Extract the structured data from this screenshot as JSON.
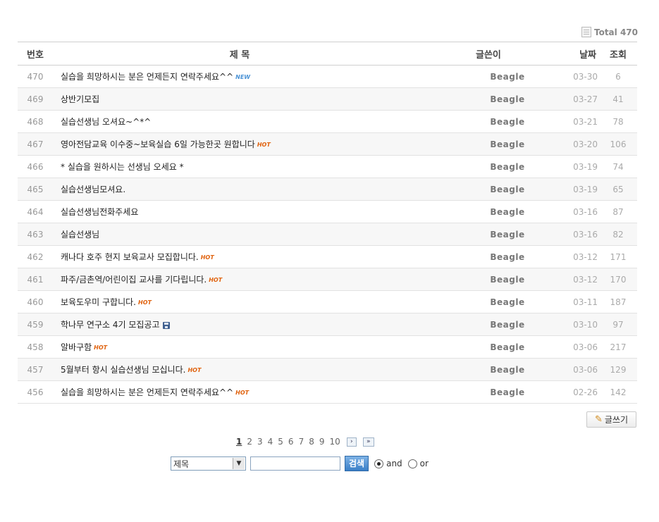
{
  "board": {
    "total_label": "Total 470",
    "columns": {
      "no": "번호",
      "title": "제 목",
      "writer": "글쓴이",
      "date": "날짜",
      "hits": "조회"
    },
    "rows": [
      {
        "no": "470",
        "title": "실습을 희망하시는 분은 언제든지 연락주세요^^",
        "badge": "NEW",
        "writer": "Beagle",
        "date": "03-30",
        "hits": "6"
      },
      {
        "no": "469",
        "title": "상반기모집",
        "badge": "",
        "writer": "Beagle",
        "date": "03-27",
        "hits": "41"
      },
      {
        "no": "468",
        "title": "실습선생님 오셔요~^*^",
        "badge": "",
        "writer": "Beagle",
        "date": "03-21",
        "hits": "78"
      },
      {
        "no": "467",
        "title": "영아전담교육 이수중~보육실습 6일 가능한곳 원합니다",
        "badge": "HOT",
        "writer": "Beagle",
        "date": "03-20",
        "hits": "106"
      },
      {
        "no": "466",
        "title": "* 실습을 원하시는 선생님 오세요 *",
        "badge": "",
        "writer": "Beagle",
        "date": "03-19",
        "hits": "74"
      },
      {
        "no": "465",
        "title": "실습선생님모셔요.",
        "badge": "",
        "writer": "Beagle",
        "date": "03-19",
        "hits": "65"
      },
      {
        "no": "464",
        "title": "실습선생님전화주세요",
        "badge": "",
        "writer": "Beagle",
        "date": "03-16",
        "hits": "87"
      },
      {
        "no": "463",
        "title": "실습선생님",
        "badge": "",
        "writer": "Beagle",
        "date": "03-16",
        "hits": "82"
      },
      {
        "no": "462",
        "title": "캐나다 호주 현지 보육교사 모집합니다.",
        "badge": "HOT",
        "writer": "Beagle",
        "date": "03-12",
        "hits": "171"
      },
      {
        "no": "461",
        "title": "파주/금촌역/어린이집 교사를 기다립니다.",
        "badge": "HOT",
        "writer": "Beagle",
        "date": "03-12",
        "hits": "170"
      },
      {
        "no": "460",
        "title": "보육도우미 구합니다.",
        "badge": "HOT",
        "writer": "Beagle",
        "date": "03-11",
        "hits": "187"
      },
      {
        "no": "459",
        "title": "학나무 연구소 4기 모집공고",
        "badge": "",
        "attachment": true,
        "writer": "Beagle",
        "date": "03-10",
        "hits": "97"
      },
      {
        "no": "458",
        "title": "알바구함",
        "badge": "HOT",
        "writer": "Beagle",
        "date": "03-06",
        "hits": "217"
      },
      {
        "no": "457",
        "title": "5월부터 항시 실습선생님 모십니다.",
        "badge": "HOT",
        "writer": "Beagle",
        "date": "03-06",
        "hits": "129"
      },
      {
        "no": "456",
        "title": "실습을 희망하시는 분은 언제든지 연락주세요^^",
        "badge": "HOT",
        "writer": "Beagle",
        "date": "02-26",
        "hits": "142"
      }
    ]
  },
  "write_button": {
    "label": "글쓰기",
    "icon": "pencil-icon"
  },
  "pagination": {
    "pages": [
      "1",
      "2",
      "3",
      "4",
      "5",
      "6",
      "7",
      "8",
      "9",
      "10"
    ],
    "current": "1"
  },
  "search": {
    "field_selected": "제목",
    "query_value": "",
    "button_label": "검색",
    "options": [
      {
        "label": "and",
        "checked": true
      },
      {
        "label": "or",
        "checked": false
      }
    ]
  }
}
